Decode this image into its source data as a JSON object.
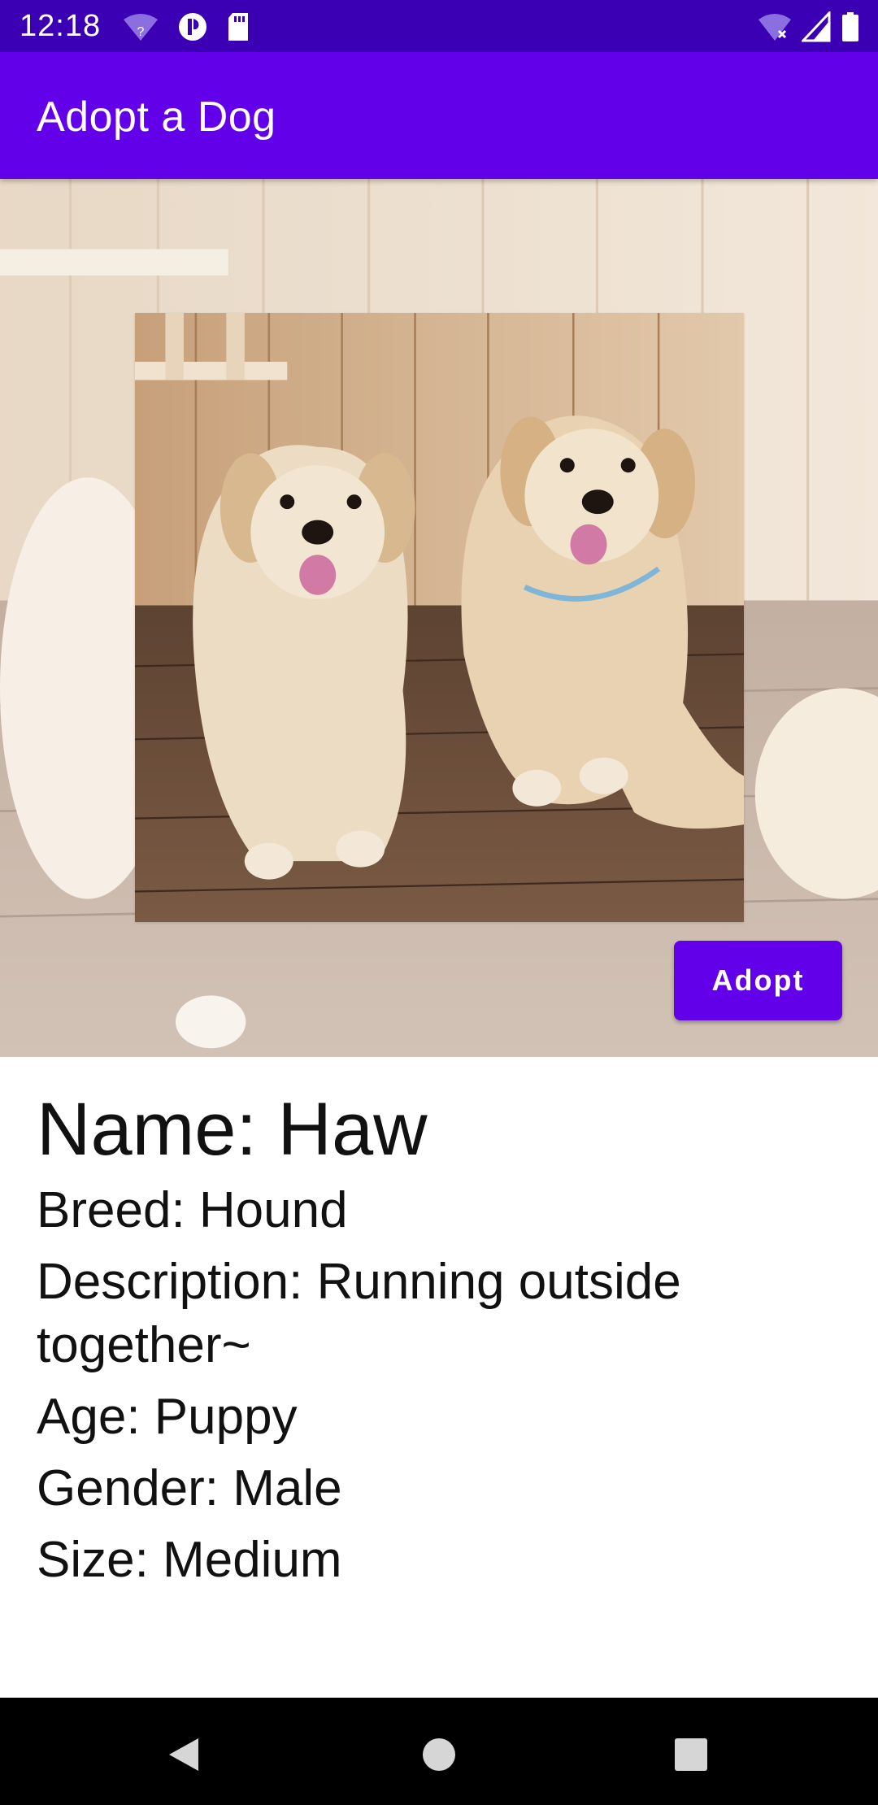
{
  "status_bar": {
    "time": "12:18",
    "icons": [
      "wifi-question-icon",
      "data-saver-icon",
      "sd-card-icon",
      "wifi-off-icon",
      "signal-icon",
      "battery-icon"
    ],
    "background_color": "#3c00b4"
  },
  "app_bar": {
    "title": "Adopt a Dog",
    "background_color": "#6200ea"
  },
  "hero": {
    "adopt_label": "Adopt"
  },
  "dog": {
    "name": "Name: Haw",
    "breed": "Breed: Hound",
    "description": "Description: Running outside together~",
    "age": "Age: Puppy",
    "gender": "Gender: Male",
    "size": "Size: Medium"
  },
  "nav_bar": {
    "icons": [
      "back-icon",
      "home-icon",
      "recent-apps-icon"
    ]
  },
  "colors": {
    "accent": "#6200ea",
    "text": "#111111"
  }
}
